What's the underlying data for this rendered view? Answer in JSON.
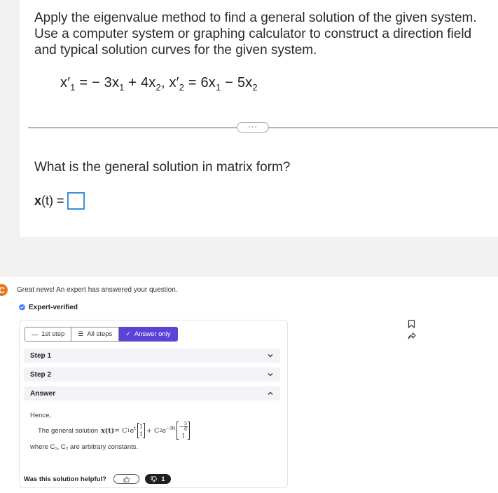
{
  "question": {
    "text": "Apply the eigenvalue method to find a general solution of the given system. Use a computer system or graphing calculator to construct a direction field and typical solution curves for the given system.",
    "equation": {
      "lhs1": "x′",
      "sub1": "1",
      "eq1": " = − 3x",
      "sub1b": "1",
      "mid1": " + 4x",
      "sub1c": "2",
      "sep": ", x′",
      "sub2": "2",
      "eq2": " = 6x",
      "sub2b": "1",
      "mid2": " − 5x",
      "sub2c": "2"
    },
    "more_label": "···",
    "subquestion": "What is the general solution in matrix form?",
    "answer_label_bold": "x",
    "answer_label_rest": "(t) ="
  },
  "response": {
    "brand_letter": "C",
    "great_news": "Great news! An expert has answered your question.",
    "expert_verified": "Expert-verified",
    "tabs": [
      {
        "label": "1st step",
        "icon": "—"
      },
      {
        "label": "All steps",
        "icon": "☰"
      },
      {
        "label": "Answer only",
        "icon": "✓"
      }
    ],
    "steps": [
      {
        "label": "Step 1"
      },
      {
        "label": "Step 2"
      },
      {
        "label": "Answer"
      }
    ],
    "answer": {
      "hence": "Hence,",
      "general_solution_prefix": "The general solution",
      "x_t": "x(t)",
      "equals": " = C",
      "c1_sub": "1",
      "e1": "e",
      "e1_exp": "t",
      "vec1_top": "1",
      "vec1_bottom": "1",
      "plus": " + C",
      "c2_sub": "2",
      "e2": "e",
      "e2_exp": "−9t",
      "vec2_top_sign": "−",
      "vec2_top_num": "5",
      "vec2_top_den": "6",
      "vec2_bottom": "1",
      "where": "where C₁, C₂ are arbitrary constants."
    },
    "helpful_label": "Was this solution helpful?",
    "dislike_count": "1"
  },
  "colors": {
    "accent_purple": "#5a44d6",
    "brand_orange": "#e87722",
    "input_blue": "#3a8fd8",
    "verified_blue": "#3b82f6"
  }
}
